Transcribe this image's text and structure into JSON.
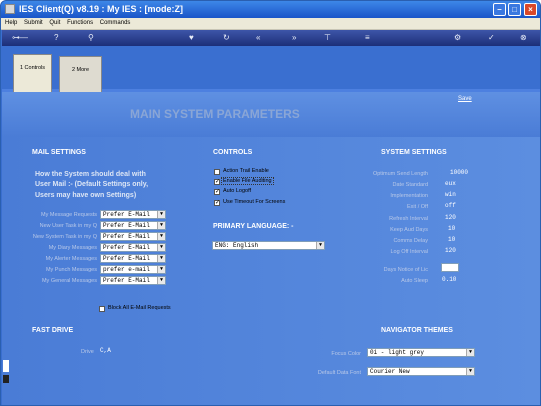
{
  "window": {
    "title": "IES Client(Q) v8.19 : My IES :    [mode:Z]"
  },
  "menu": [
    "Help",
    "Submit",
    "Quit",
    "Functions",
    "Commands"
  ],
  "tabs": [
    {
      "label": "1 Controls"
    },
    {
      "label": "2 More"
    }
  ],
  "save_label": "Save",
  "page_title": "MAIN SYSTEM PARAMETERS",
  "mail": {
    "heading": "MAIL SETTINGS",
    "description": [
      "How the System should deal with",
      "User Mail :- (Default Settings only,",
      "Users may have own Settings)"
    ],
    "rows": [
      {
        "label": "My Message Requests",
        "value": "Prefer E-Mail"
      },
      {
        "label": "New User Task in my Q",
        "value": "Prefer E-Mail"
      },
      {
        "label": "New System Task in my Q",
        "value": "Prefer E-Mail"
      },
      {
        "label": "My Diary Messages",
        "value": "Prefer E-Mail"
      },
      {
        "label": "My Alerter Messages",
        "value": "Prefer E-Mail"
      },
      {
        "label": "My Punch Messages",
        "value": "prefer e-mail"
      },
      {
        "label": "My General Messages",
        "value": "Prefer E-Mail"
      }
    ],
    "block_all_label": "Block All E-Mail Requests"
  },
  "controls": {
    "heading": "CONTROLS",
    "items": [
      {
        "label": "Action Trail Enable",
        "checked": false
      },
      {
        "label": "Enable File Auditing",
        "checked": true
      },
      {
        "label": "Auto Logoff",
        "checked": true
      },
      {
        "label": "Use Timeout For Screens",
        "checked": true
      }
    ],
    "primary_language_heading": "PRIMARY LANGUAGE: -",
    "language_value": "ENG: English"
  },
  "system": {
    "heading": "SYSTEM SETTINGS",
    "rows": [
      {
        "label": "Optimum Send Length",
        "value": "10000"
      },
      {
        "label": "Date Standard",
        "value": "eux"
      },
      {
        "label": "Implementation",
        "value": "win"
      },
      {
        "label": "Exit / Off",
        "value": "off"
      },
      {
        "label": "Refresh Interval",
        "value": "120"
      },
      {
        "label": "Keep Aud Days",
        "value": "10"
      },
      {
        "label": "Comms Delay",
        "value": "10"
      },
      {
        "label": "Log Off Interval",
        "value": "120"
      },
      {
        "label": "Days Notice of Lic",
        "value": ""
      },
      {
        "label": "Auto Sleep",
        "value": "0.10"
      }
    ]
  },
  "fast_drive": {
    "heading": "FAST DRIVE",
    "label": "Drive",
    "value": "C,A"
  },
  "navigator": {
    "heading": "NAVIGATOR THEMES",
    "focus_color_label": "Focus Color",
    "focus_color_value": "0i - light grey",
    "default_font_label": "Default Data Font",
    "default_font_value": "Courier New"
  }
}
